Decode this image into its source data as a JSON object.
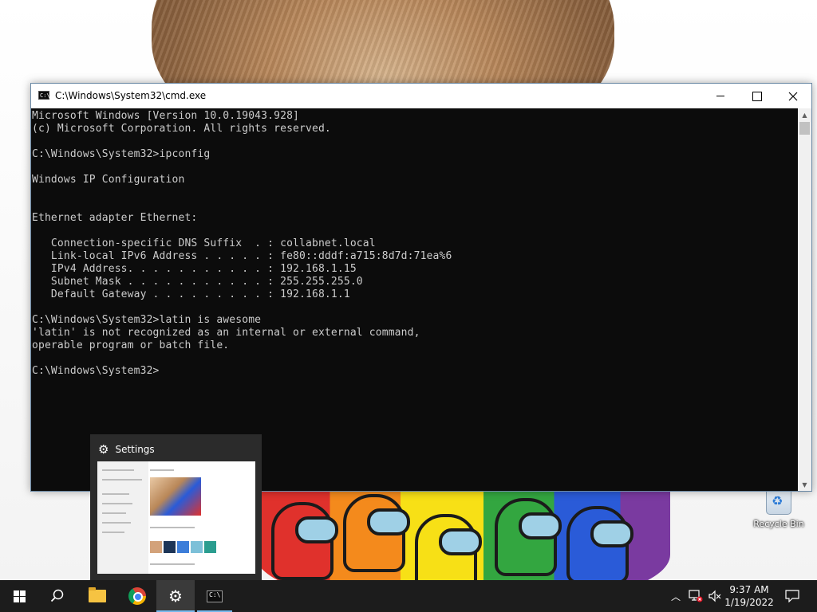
{
  "window": {
    "title": "C:\\Windows\\System32\\cmd.exe",
    "icon": "cmd-icon",
    "lines": [
      "Microsoft Windows [Version 10.0.19043.928]",
      "(c) Microsoft Corporation. All rights reserved.",
      "",
      "C:\\Windows\\System32>ipconfig",
      "",
      "Windows IP Configuration",
      "",
      "",
      "Ethernet adapter Ethernet:",
      "",
      "   Connection-specific DNS Suffix  . : collabnet.local",
      "   Link-local IPv6 Address . . . . . : fe80::dddf:a715:8d7d:71ea%6",
      "   IPv4 Address. . . . . . . . . . . : 192.168.1.15",
      "   Subnet Mask . . . . . . . . . . . : 255.255.255.0",
      "   Default Gateway . . . . . . . . . : 192.168.1.1",
      "",
      "C:\\Windows\\System32>latin is awesome",
      "'latin' is not recognized as an internal or external command,",
      "operable program or batch file.",
      "",
      "C:\\Windows\\System32>"
    ],
    "colors": {
      "background": "#0c0c0c",
      "text": "#cccccc"
    }
  },
  "taskbar_preview": {
    "title": "Settings",
    "icon": "gear-icon"
  },
  "desktop": {
    "recycle_bin_label": "Recycle Bin"
  },
  "taskbar": {
    "items": [
      "start-icon",
      "search-icon",
      "file-explorer-icon",
      "chrome-icon",
      "settings-icon",
      "cmd-icon"
    ],
    "active_item": "settings-icon",
    "clock": {
      "time": "9:37 AM",
      "date": "1/19/2022"
    },
    "accent_color": "#76b9ed"
  }
}
